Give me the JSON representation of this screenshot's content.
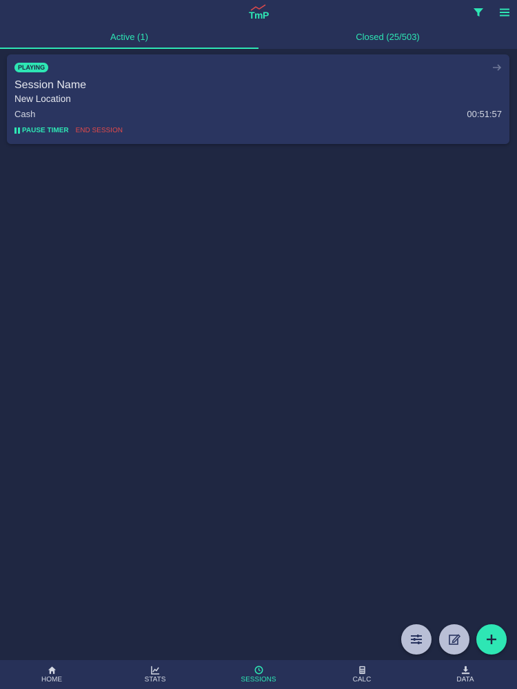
{
  "app": {
    "logo_text": "TmP"
  },
  "tabs": [
    {
      "label": "Active (1)",
      "active": true
    },
    {
      "label": "Closed (25/503)",
      "active": false
    }
  ],
  "session": {
    "status": "PLAYING",
    "name": "Session Name",
    "location": "New Location",
    "game_type": "Cash",
    "elapsed": "00:51:57",
    "pause_label": "PAUSE TIMER",
    "end_label": "END SESSION"
  },
  "nav": [
    {
      "label": "HOME",
      "icon": "home-icon",
      "active": false
    },
    {
      "label": "STATS",
      "icon": "chart-icon",
      "active": false
    },
    {
      "label": "SESSIONS",
      "icon": "clock-icon",
      "active": true
    },
    {
      "label": "CALC",
      "icon": "calculator-icon",
      "active": false
    },
    {
      "label": "DATA",
      "icon": "download-icon",
      "active": false
    }
  ],
  "colors": {
    "background": "#1f2742",
    "bar": "#273158",
    "card": "#2a3560",
    "accent": "#2ee6b4",
    "danger": "#e04a4a",
    "fab_secondary": "#b9bfd6"
  }
}
